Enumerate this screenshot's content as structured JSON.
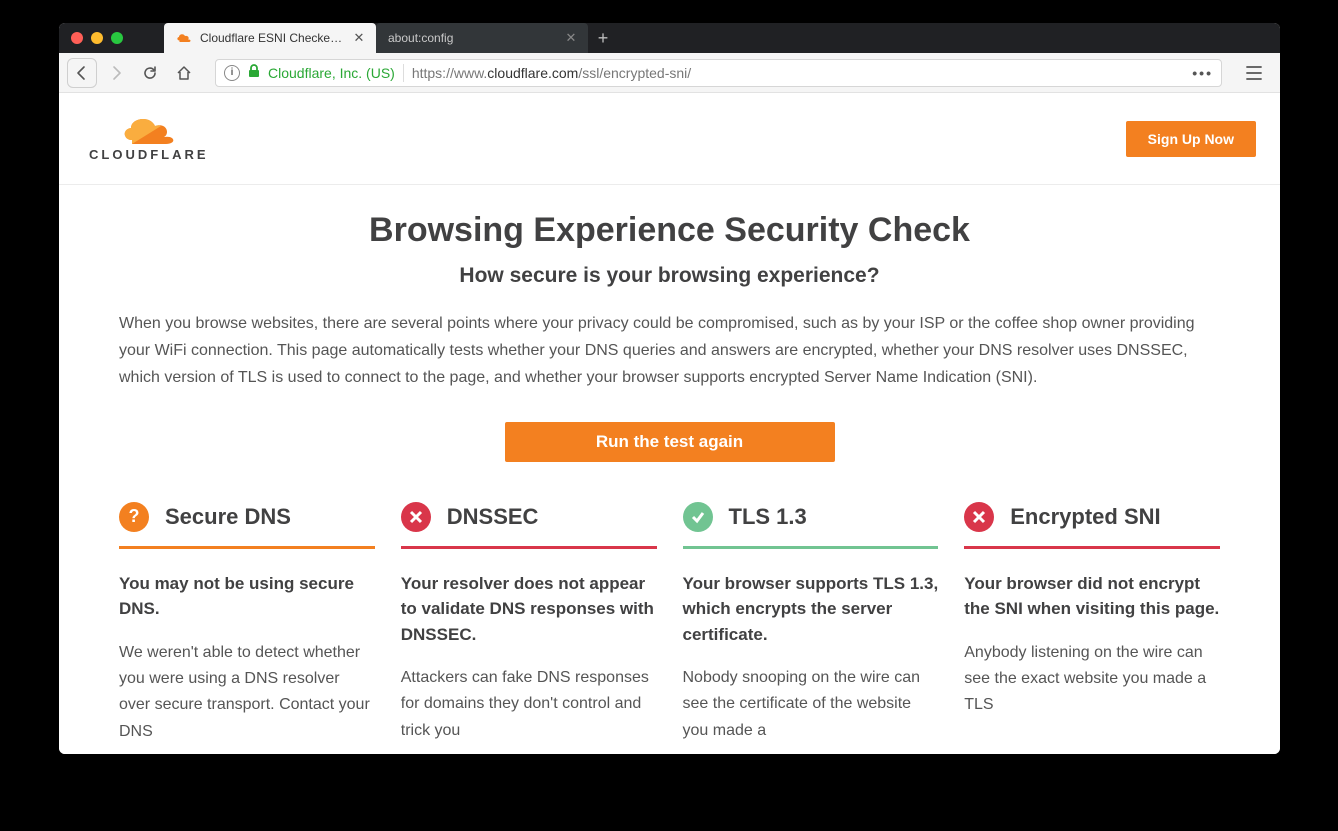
{
  "browser": {
    "tabs": [
      {
        "title": "Cloudflare ESNI Checker | Cloud",
        "active": true
      },
      {
        "title": "about:config",
        "active": false
      }
    ],
    "cert_label": "Cloudflare, Inc. (US)",
    "url_prefix": "https://www.",
    "url_host": "cloudflare.com",
    "url_path": "/ssl/encrypted-sni/"
  },
  "site": {
    "logo_word": "CLOUDFLARE",
    "signup": "Sign Up Now"
  },
  "hero": {
    "title": "Browsing Experience Security Check",
    "subtitle": "How secure is your browsing experience?",
    "body": "When you browse websites, there are several points where your privacy could be compromised, such as by your ISP or the coffee shop owner providing your WiFi connection. This page automatically tests whether your DNS queries and answers are encrypted, whether your DNS resolver uses DNSSEC, which version of TLS is used to connect to the page, and whether your browser supports encrypted Server Name Indication (SNI).",
    "run": "Run the test again"
  },
  "results": [
    {
      "id": "secure-dns",
      "status": "question",
      "color": "orange",
      "title": "Secure DNS",
      "lead": "You may not be using secure DNS.",
      "body": "We weren't able to detect whether you were using a DNS resolver over secure transport. Contact your DNS"
    },
    {
      "id": "dnssec",
      "status": "fail",
      "color": "red",
      "title": "DNSSEC",
      "lead": "Your resolver does not appear to validate DNS responses with DNSSEC.",
      "body": "Attackers can fake DNS responses for domains they don't control and trick you"
    },
    {
      "id": "tls13",
      "status": "pass",
      "color": "green",
      "title": "TLS 1.3",
      "lead": "Your browser supports TLS 1.3, which encrypts the server certificate.",
      "body": "Nobody snooping on the wire can see the certificate of the website you made a"
    },
    {
      "id": "esni",
      "status": "fail",
      "color": "red",
      "title": "Encrypted SNI",
      "lead": "Your browser did not encrypt the SNI when visiting this page.",
      "body": "Anybody listening on the wire can see the exact website you made a TLS"
    }
  ]
}
